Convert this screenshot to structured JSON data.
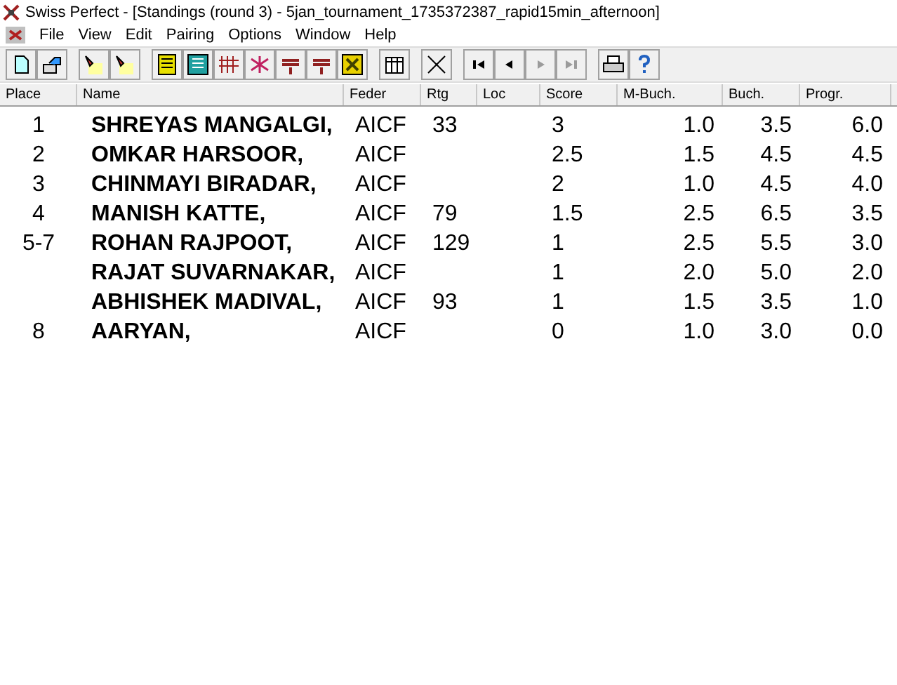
{
  "window": {
    "title": "Swiss Perfect - [Standings  (round 3) - 5jan_tournament_1735372387_rapid15min_afternoon]"
  },
  "menu": [
    "File",
    "View",
    "Edit",
    "Pairing",
    "Options",
    "Window",
    "Help"
  ],
  "toolbar": [
    [
      {
        "kind": "new",
        "disabled": false
      },
      {
        "kind": "open",
        "disabled": false
      }
    ],
    [
      {
        "kind": "lamp",
        "disabled": false
      },
      {
        "kind": "lamp",
        "disabled": false
      }
    ],
    [
      {
        "kind": "sheet",
        "disabled": false
      },
      {
        "kind": "list",
        "disabled": false
      },
      {
        "kind": "grid",
        "disabled": false
      },
      {
        "kind": "spark",
        "disabled": false
      },
      {
        "kind": "stripes",
        "disabled": false
      },
      {
        "kind": "stripes",
        "disabled": false
      },
      {
        "kind": "square",
        "disabled": false
      }
    ],
    [
      {
        "kind": "table",
        "disabled": false
      }
    ],
    [
      {
        "kind": "cross",
        "disabled": false
      }
    ],
    [
      {
        "kind": "first",
        "disabled": false
      },
      {
        "kind": "prev",
        "disabled": false
      },
      {
        "kind": "next",
        "disabled": true
      },
      {
        "kind": "last",
        "disabled": true
      }
    ],
    [
      {
        "kind": "print",
        "disabled": false
      },
      {
        "kind": "help",
        "disabled": false
      }
    ]
  ],
  "table": {
    "columns": [
      "Place",
      "Name",
      "Feder",
      "Rtg",
      "Loc",
      "Score",
      "M-Buch.",
      "Buch.",
      "Progr."
    ],
    "rows": [
      {
        "place": "1",
        "name": "SHREYAS MANGALGI,",
        "feder": "AICF",
        "rtg": "33",
        "score": "3",
        "mbuch": "1.0",
        "buch": "3.5",
        "progr": "6.0"
      },
      {
        "place": "2",
        "name": "OMKAR HARSOOR,",
        "feder": "AICF",
        "rtg": "",
        "score": "2.5",
        "mbuch": "1.5",
        "buch": "4.5",
        "progr": "4.5"
      },
      {
        "place": "3",
        "name": "CHINMAYI BIRADAR,",
        "feder": "AICF",
        "rtg": "",
        "score": "2",
        "mbuch": "1.0",
        "buch": "4.5",
        "progr": "4.0"
      },
      {
        "place": "4",
        "name": "MANISH KATTE,",
        "feder": "AICF",
        "rtg": "79",
        "score": "1.5",
        "mbuch": "2.5",
        "buch": "6.5",
        "progr": "3.5"
      },
      {
        "place": "5-7",
        "name": "ROHAN RAJPOOT,",
        "feder": "AICF",
        "rtg": "129",
        "score": "1",
        "mbuch": "2.5",
        "buch": "5.5",
        "progr": "3.0"
      },
      {
        "place": "",
        "name": "RAJAT SUVARNAKAR,",
        "feder": "AICF",
        "rtg": "",
        "score": "1",
        "mbuch": "2.0",
        "buch": "5.0",
        "progr": "2.0"
      },
      {
        "place": "",
        "name": "ABHISHEK MADIVAL,",
        "feder": "AICF",
        "rtg": "93",
        "score": "1",
        "mbuch": "1.5",
        "buch": "3.5",
        "progr": "1.0"
      },
      {
        "place": "8",
        "name": "AARYAN,",
        "feder": "AICF",
        "rtg": "",
        "score": "0",
        "mbuch": "1.0",
        "buch": "3.0",
        "progr": "0.0"
      }
    ]
  }
}
